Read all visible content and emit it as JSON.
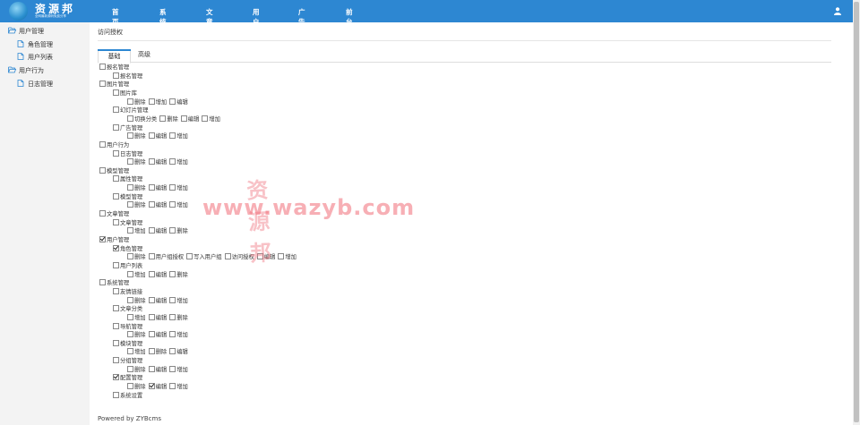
{
  "brand": {
    "title": "资源邦",
    "subtitle": "全网最新源码免费分享"
  },
  "nav": [
    "首页",
    "系统",
    "文章",
    "用户",
    "广告",
    "前台"
  ],
  "sidebar": [
    {
      "label": "用户管理",
      "type": "folder"
    },
    {
      "label": "角色管理",
      "type": "file"
    },
    {
      "label": "用户列表",
      "type": "file"
    },
    {
      "label": "用户行为",
      "type": "folder"
    },
    {
      "label": "日志管理",
      "type": "file"
    }
  ],
  "breadcrumb": "访问授权",
  "tabs": [
    "基础",
    "高级"
  ],
  "tree": [
    {
      "level": 0,
      "items": [
        {
          "label": "报名管理",
          "checked": false
        }
      ]
    },
    {
      "level": 1,
      "items": [
        {
          "label": "报名管理",
          "checked": false
        }
      ]
    },
    {
      "level": 0,
      "items": [
        {
          "label": "图片管理",
          "checked": false
        }
      ]
    },
    {
      "level": 1,
      "items": [
        {
          "label": "图片库",
          "checked": false
        }
      ]
    },
    {
      "level": 2,
      "items": [
        {
          "label": "删除",
          "checked": false
        },
        {
          "label": "增加",
          "checked": false
        },
        {
          "label": "编辑",
          "checked": false
        }
      ]
    },
    {
      "level": 1,
      "items": [
        {
          "label": "幻灯片管理",
          "checked": false
        }
      ]
    },
    {
      "level": 2,
      "items": [
        {
          "label": "切换分类",
          "checked": false
        },
        {
          "label": "删除",
          "checked": false
        },
        {
          "label": "编辑",
          "checked": false
        },
        {
          "label": "增加",
          "checked": false
        }
      ]
    },
    {
      "level": 1,
      "items": [
        {
          "label": "广告管理",
          "checked": false
        }
      ]
    },
    {
      "level": 2,
      "items": [
        {
          "label": "删除",
          "checked": false
        },
        {
          "label": "编辑",
          "checked": false
        },
        {
          "label": "增加",
          "checked": false
        }
      ]
    },
    {
      "level": 0,
      "items": [
        {
          "label": "用户行为",
          "checked": false
        }
      ]
    },
    {
      "level": 1,
      "items": [
        {
          "label": "日志管理",
          "checked": false
        }
      ]
    },
    {
      "level": 2,
      "items": [
        {
          "label": "删除",
          "checked": false
        },
        {
          "label": "编辑",
          "checked": false
        },
        {
          "label": "增加",
          "checked": false
        }
      ]
    },
    {
      "level": 0,
      "items": [
        {
          "label": "模型管理",
          "checked": false
        }
      ]
    },
    {
      "level": 1,
      "items": [
        {
          "label": "属性管理",
          "checked": false
        }
      ]
    },
    {
      "level": 2,
      "items": [
        {
          "label": "删除",
          "checked": false
        },
        {
          "label": "编辑",
          "checked": false
        },
        {
          "label": "增加",
          "checked": false
        }
      ]
    },
    {
      "level": 1,
      "items": [
        {
          "label": "模型管理",
          "checked": false
        }
      ]
    },
    {
      "level": 2,
      "items": [
        {
          "label": "删除",
          "checked": false
        },
        {
          "label": "编辑",
          "checked": false
        },
        {
          "label": "增加",
          "checked": false
        }
      ]
    },
    {
      "level": 0,
      "items": [
        {
          "label": "文章管理",
          "checked": false
        }
      ]
    },
    {
      "level": 1,
      "items": [
        {
          "label": "文章管理",
          "checked": false
        }
      ]
    },
    {
      "level": 2,
      "items": [
        {
          "label": "增加",
          "checked": false
        },
        {
          "label": "编辑",
          "checked": false
        },
        {
          "label": "删除",
          "checked": false
        }
      ]
    },
    {
      "level": 0,
      "items": [
        {
          "label": "用户管理",
          "checked": true
        }
      ]
    },
    {
      "level": 1,
      "items": [
        {
          "label": "角色管理",
          "checked": true
        }
      ]
    },
    {
      "level": 2,
      "items": [
        {
          "label": "删除",
          "checked": false
        },
        {
          "label": "用户组授权",
          "checked": false
        },
        {
          "label": "写入用户组",
          "checked": false
        },
        {
          "label": "访问授权",
          "checked": false
        },
        {
          "label": "编辑",
          "checked": false
        },
        {
          "label": "增加",
          "checked": false
        }
      ]
    },
    {
      "level": 1,
      "items": [
        {
          "label": "用户列表",
          "checked": false
        }
      ]
    },
    {
      "level": 2,
      "items": [
        {
          "label": "增加",
          "checked": false
        },
        {
          "label": "编辑",
          "checked": false
        },
        {
          "label": "删除",
          "checked": false
        }
      ]
    },
    {
      "level": 0,
      "items": [
        {
          "label": "系统管理",
          "checked": false
        }
      ]
    },
    {
      "level": 1,
      "items": [
        {
          "label": "友情链接",
          "checked": false
        }
      ]
    },
    {
      "level": 2,
      "items": [
        {
          "label": "删除",
          "checked": false
        },
        {
          "label": "编辑",
          "checked": false
        },
        {
          "label": "增加",
          "checked": false
        }
      ]
    },
    {
      "level": 1,
      "items": [
        {
          "label": "文章分类",
          "checked": false
        }
      ]
    },
    {
      "level": 2,
      "items": [
        {
          "label": "增加",
          "checked": false
        },
        {
          "label": "编辑",
          "checked": false
        },
        {
          "label": "删除",
          "checked": false
        }
      ]
    },
    {
      "level": 1,
      "items": [
        {
          "label": "导航管理",
          "checked": false
        }
      ]
    },
    {
      "level": 2,
      "items": [
        {
          "label": "删除",
          "checked": false
        },
        {
          "label": "编辑",
          "checked": false
        },
        {
          "label": "增加",
          "checked": false
        }
      ]
    },
    {
      "level": 1,
      "items": [
        {
          "label": "模块管理",
          "checked": false
        }
      ]
    },
    {
      "level": 2,
      "items": [
        {
          "label": "增加",
          "checked": false
        },
        {
          "label": "删除",
          "checked": false
        },
        {
          "label": "编辑",
          "checked": false
        }
      ]
    },
    {
      "level": 1,
      "items": [
        {
          "label": "分组管理",
          "checked": false
        }
      ]
    },
    {
      "level": 2,
      "items": [
        {
          "label": "删除",
          "checked": false
        },
        {
          "label": "编辑",
          "checked": false
        },
        {
          "label": "增加",
          "checked": false
        }
      ]
    },
    {
      "level": 1,
      "items": [
        {
          "label": "配置管理",
          "checked": true
        }
      ]
    },
    {
      "level": 2,
      "items": [
        {
          "label": "删除",
          "checked": false
        },
        {
          "label": "编辑",
          "checked": true
        },
        {
          "label": "增加",
          "checked": false
        }
      ]
    },
    {
      "level": 1,
      "items": [
        {
          "label": "系统设置",
          "checked": false
        }
      ]
    }
  ],
  "footer": "Powered by ZYBcms",
  "watermark": {
    "cn": "资源邦",
    "en": "www.wazyb.com"
  },
  "colors": {
    "header": "#2d87d2",
    "sidebar": "#f3f3f3",
    "folder_icon": "#2d87d2"
  }
}
